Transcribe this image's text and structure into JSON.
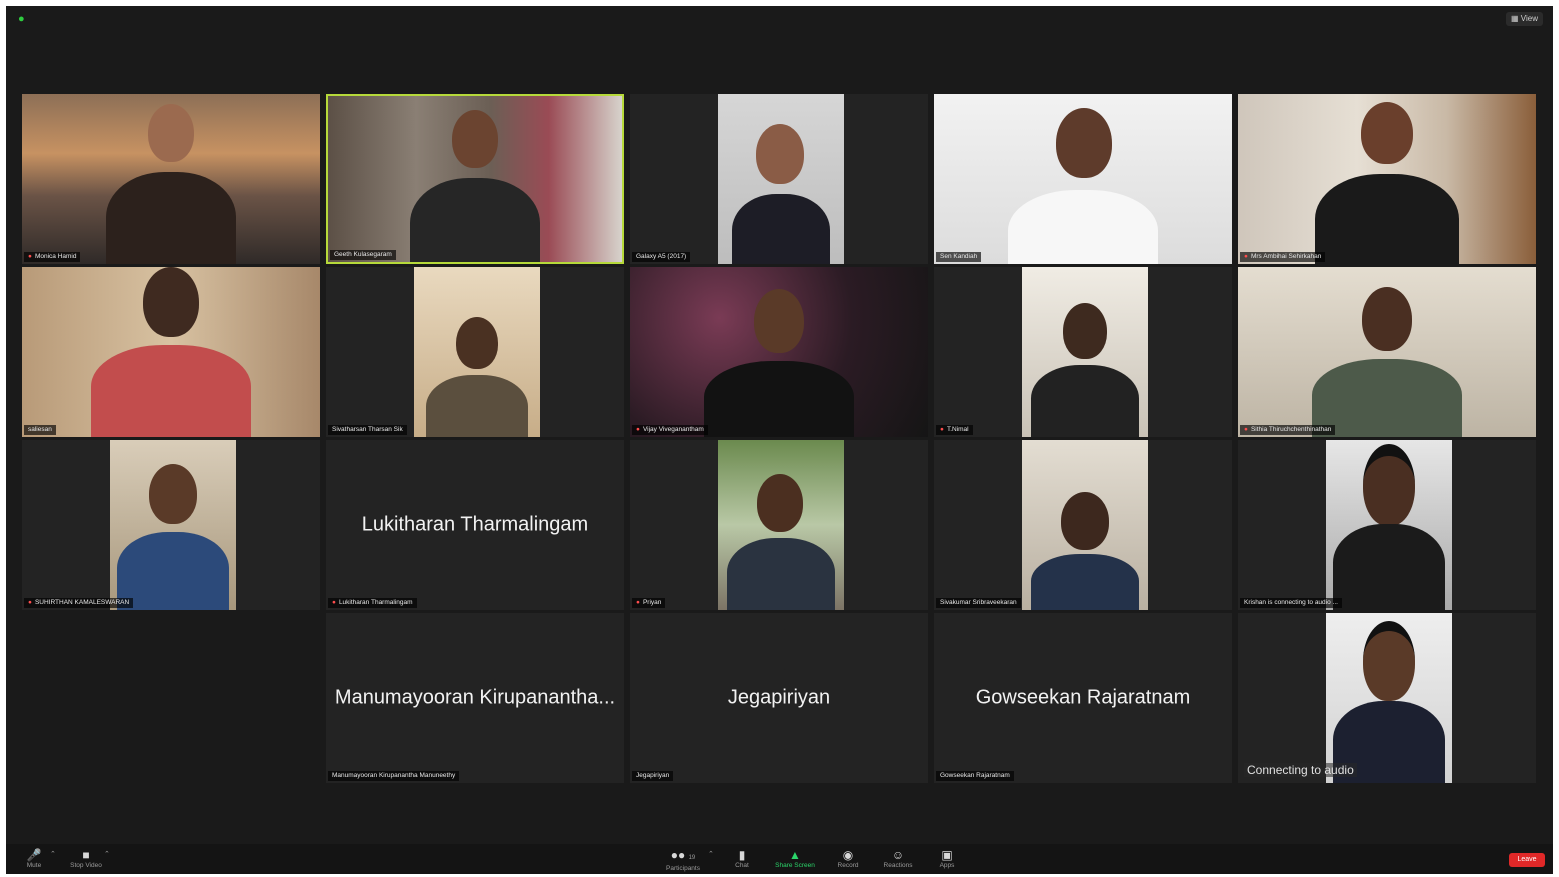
{
  "window": {
    "view_label": "View"
  },
  "participants": [
    {
      "name": "Monica Hamid",
      "muted": true
    },
    {
      "name": "Geeth Kulasegaram",
      "muted": false
    },
    {
      "name": "Galaxy A5 (2017)",
      "muted": false
    },
    {
      "name": "Sen Kandiah",
      "muted": false
    },
    {
      "name": "Mrs Ambihai Sehirkahan",
      "muted": true
    },
    {
      "name": "saliesan",
      "muted": false
    },
    {
      "name": "Sivatharsan Tharsan Sik",
      "muted": false
    },
    {
      "name": "Vijay Viveganantham",
      "muted": true
    },
    {
      "name": "T.Nimal",
      "muted": true
    },
    {
      "name": "Sithia Thiruchchenthinathan",
      "muted": true
    },
    {
      "name": "SUHIRTHAN KAMALESWARAN",
      "muted": true
    },
    {
      "name": "Lukitharan Tharmalingam",
      "display": "Lukitharan Tharmalingam",
      "muted": true
    },
    {
      "name": "Priyan",
      "muted": true
    },
    {
      "name": "Sivakumar Sribraveekaran",
      "muted": false
    },
    {
      "name": "Krishan is connecting to audio ...",
      "muted": false
    },
    {
      "name": "Manumayooran Kirupanantha Manuneethy",
      "display": "Manumayooran Kirupanantha...",
      "muted": false
    },
    {
      "name": "Jegapiriyan",
      "display": "Jegapiriyan",
      "muted": false
    },
    {
      "name": "Gowseekan Rajaratnam",
      "display": "Gowseekan Rajaratnam",
      "muted": false
    },
    {
      "name": "",
      "connecting_text": "Connecting to audio",
      "muted": false
    }
  ],
  "toolbar": {
    "mute": "Mute",
    "stop_video": "Stop Video",
    "participants": "Participants",
    "participants_count": "19",
    "chat": "Chat",
    "share_screen": "Share Screen",
    "record": "Record",
    "reactions": "Reactions",
    "apps": "Apps",
    "leave": "Leave"
  },
  "colors": {
    "active_speaker": "#b6d93a",
    "leave": "#e02828",
    "share": "#2bd56a"
  }
}
